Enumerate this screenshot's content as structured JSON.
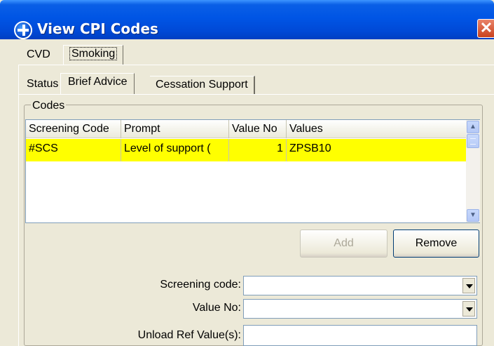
{
  "window": {
    "title": "View CPI Codes",
    "close_label": "✕"
  },
  "outer_tabs": [
    {
      "label": "CVD",
      "selected": false
    },
    {
      "label": "Smoking",
      "selected": true
    }
  ],
  "inner_tabs": [
    {
      "label": "Status",
      "selected": false
    },
    {
      "label": "Brief Advice",
      "selected": true
    },
    {
      "label": "Cessation Support",
      "selected": false
    }
  ],
  "codes_group": {
    "legend": "Codes",
    "columns": [
      "Screening Code",
      "Prompt",
      "Value No",
      "Values"
    ],
    "rows": [
      {
        "screening_code": "#SCS",
        "prompt": "Level of support (",
        "value_no": "1",
        "values": "ZPSB10",
        "highlight": "#ffff00"
      }
    ]
  },
  "buttons": {
    "add": "Add",
    "remove": "Remove"
  },
  "form": {
    "screening_code_label": "Screening code:",
    "screening_code_value": "",
    "value_no_label": "Value No:",
    "value_no_value": "",
    "unload_ref_label": "Unload Ref Value(s):",
    "unload_ref_value": ""
  },
  "colors": {
    "titlebar": "#0055e5",
    "selected_row": "#ffff00",
    "window_bg": "#ece9d8"
  }
}
